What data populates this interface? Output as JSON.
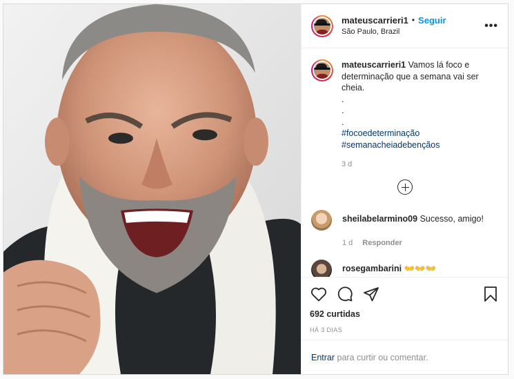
{
  "header": {
    "username": "mateuscarrieri1",
    "separator": "•",
    "follow_label": "Seguir",
    "location": "São Paulo, Brazil",
    "more_label": "•••"
  },
  "caption": {
    "username": "mateuscarrieri1",
    "text": "Vamos lá foco e determinação que a semana vai ser cheia.",
    "dots": [
      ".",
      ".",
      "."
    ],
    "hashtags": [
      "#focoedeterminação",
      "#semanacheiadebençãos"
    ],
    "time": "3 d"
  },
  "comments": [
    {
      "username": "sheilabelarmino09",
      "text": "Sucesso, amigo!",
      "time": "1 d",
      "reply_label": "Responder"
    },
    {
      "username": "rosegambarini",
      "text": "👐👐👐"
    }
  ],
  "actions": {
    "icons": [
      "heart-icon",
      "comment-icon",
      "share-icon",
      "bookmark-icon"
    ],
    "likes": "692 curtidas",
    "date": "HÁ 3 DIAS"
  },
  "add_comment": {
    "link_label": "Entrar",
    "rest_text": "para curtir ou comentar."
  },
  "colors": {
    "link_blue": "#0095f6",
    "hashtag_blue": "#00376b",
    "muted": "#8e8e8e",
    "border": "#dbdbdb"
  }
}
